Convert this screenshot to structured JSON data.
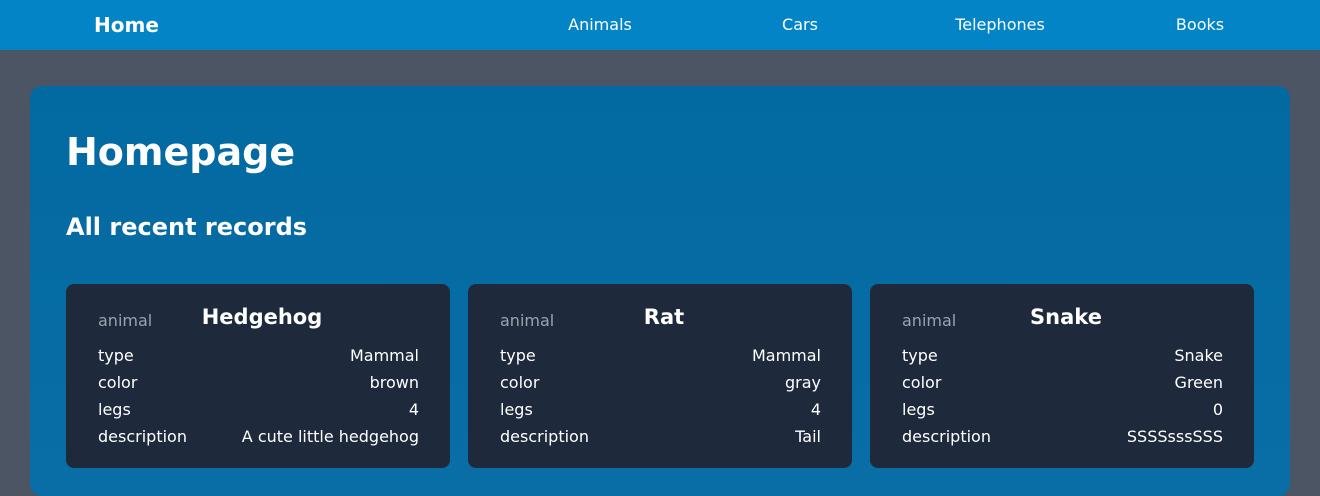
{
  "nav": {
    "home": "Home",
    "links": [
      "Animals",
      "Cars",
      "Telephones",
      "Books"
    ]
  },
  "main": {
    "title": "Homepage",
    "section_title": "All recent records"
  },
  "records": [
    {
      "kind": "animal",
      "name": "Hedgehog",
      "fields": [
        {
          "key": "type",
          "value": "Mammal"
        },
        {
          "key": "color",
          "value": "brown"
        },
        {
          "key": "legs",
          "value": "4"
        },
        {
          "key": "description",
          "value": "A cute little hedgehog"
        }
      ]
    },
    {
      "kind": "animal",
      "name": "Rat",
      "fields": [
        {
          "key": "type",
          "value": "Mammal"
        },
        {
          "key": "color",
          "value": "gray"
        },
        {
          "key": "legs",
          "value": "4"
        },
        {
          "key": "description",
          "value": "Tail"
        }
      ]
    },
    {
      "kind": "animal",
      "name": "Snake",
      "fields": [
        {
          "key": "type",
          "value": "Snake"
        },
        {
          "key": "color",
          "value": "Green"
        },
        {
          "key": "legs",
          "value": "0"
        },
        {
          "key": "description",
          "value": "SSSSsssSSS"
        }
      ]
    }
  ],
  "colors": {
    "navbar": "#0284c7",
    "background": "#4b5563",
    "panel": "#0369a1",
    "card": "#1e293b",
    "muted_text": "#9ca3af"
  }
}
